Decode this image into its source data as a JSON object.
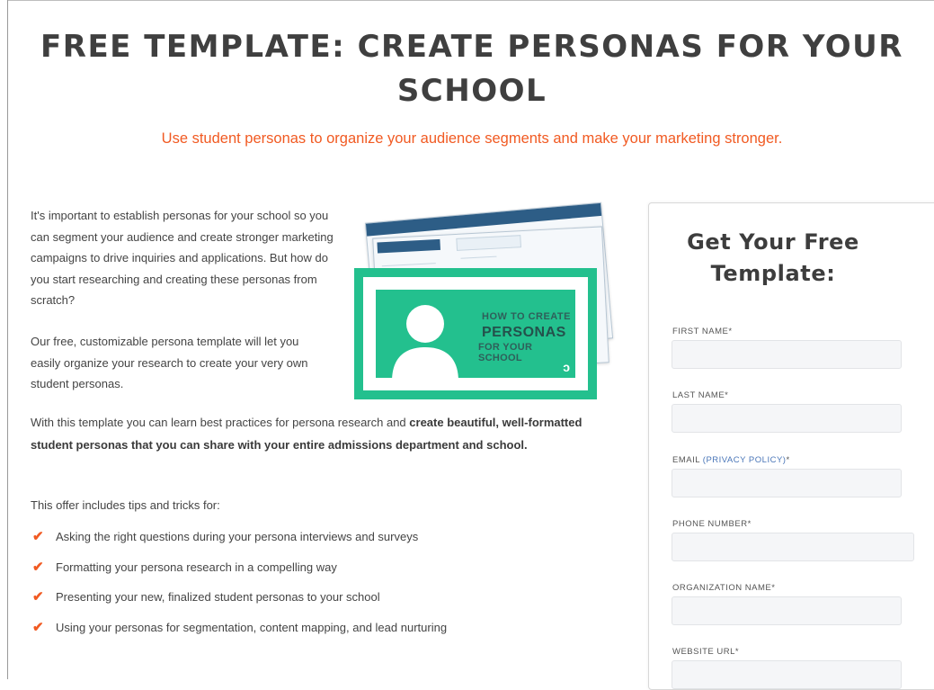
{
  "page": {
    "title": "FREE TEMPLATE: CREATE PERSONAS FOR YOUR SCHOOL",
    "subtitle": "Use student personas to organize your audience segments and make your marketing stronger."
  },
  "body": {
    "intro": "It's important to establish personas for your school so you can segment your audience and create stronger marketing campaigns to drive inquiries and applications. But how do you start researching and creating these personas from scratch?",
    "para2": "Our free, customizable persona template will let you easily organize your research to create your very own student personas.",
    "para3_start": "With this template you can learn best practices for persona research and ",
    "para3_bold": "create beautiful, well-formatted student personas that you can share with your entire admissions department and school.",
    "offer_intro": "This offer includes tips and tricks for:",
    "tips": [
      "Asking the right questions during your persona interviews and surveys",
      "Formatting your persona research in a compelling way",
      "Presenting your new, finalized student personas to your school",
      "Using your personas for segmentation, content mapping, and lead nurturing"
    ]
  },
  "illustration": {
    "line1": "HOW TO CREATE",
    "line2": "PERSONAS",
    "line3": "FOR YOUR SCHOOL",
    "brand_color": "#23c08e",
    "icon": "person-silhouette-icon"
  },
  "form": {
    "title": "Get Your Free Template:",
    "fields": [
      {
        "label": "FIRST NAME*",
        "value": ""
      },
      {
        "label": "LAST NAME*",
        "value": ""
      },
      {
        "label_prefix": "EMAIL ",
        "label_link": "(PRIVACY POLICY)",
        "label_suffix": "*",
        "value": ""
      },
      {
        "label": "PHONE NUMBER*",
        "value": ""
      },
      {
        "label": "ORGANIZATION NAME*",
        "value": ""
      },
      {
        "label": "WEBSITE URL*",
        "value": ""
      }
    ]
  },
  "colors": {
    "accent": "#f15a22",
    "heading": "#3f3f3f",
    "link": "#4a76b8"
  }
}
